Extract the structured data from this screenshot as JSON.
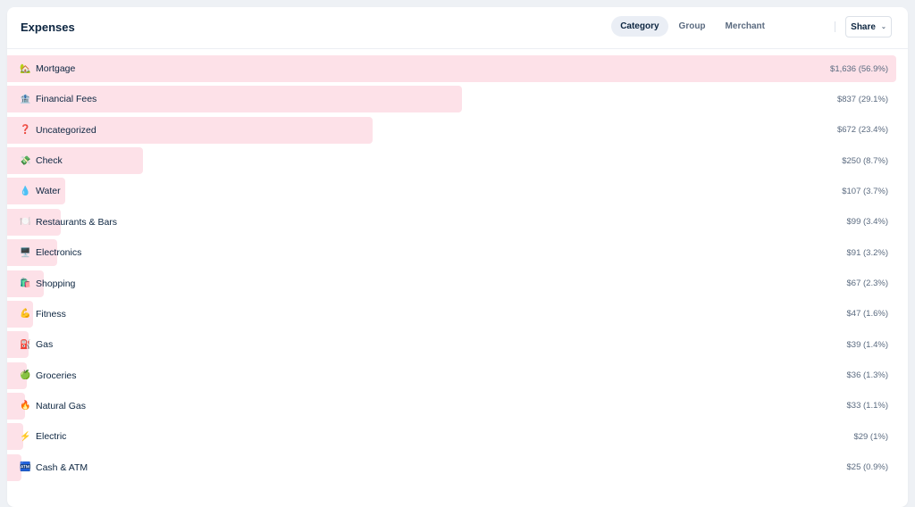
{
  "header": {
    "title": "Expenses",
    "tabs": [
      {
        "label": "Category",
        "active": true
      },
      {
        "label": "Group",
        "active": false
      },
      {
        "label": "Merchant",
        "active": false
      }
    ],
    "share_label": "Share",
    "share_icon": "chevron-down-icon"
  },
  "colors": {
    "bar": "#fde1e8",
    "text": "#0c2540",
    "muted": "#5b6b80"
  },
  "categories": [
    {
      "emoji": "🏡",
      "name": "Mortgage",
      "amount": "$1,636 (56.9%)",
      "share": 1.0
    },
    {
      "emoji": "🏦",
      "name": "Financial Fees",
      "amount": "$837 (29.1%)",
      "share": 0.512
    },
    {
      "emoji": "❓",
      "name": "Uncategorized",
      "amount": "$672 (23.4%)",
      "share": 0.411
    },
    {
      "emoji": "💸",
      "name": "Check",
      "amount": "$250 (8.7%)",
      "share": 0.153
    },
    {
      "emoji": "💧",
      "name": "Water",
      "amount": "$107 (3.7%)",
      "share": 0.065
    },
    {
      "emoji": "🍽️",
      "name": "Restaurants & Bars",
      "amount": "$99 (3.4%)",
      "share": 0.06
    },
    {
      "emoji": "🖥️",
      "name": "Electronics",
      "amount": "$91 (3.2%)",
      "share": 0.056
    },
    {
      "emoji": "🛍️",
      "name": "Shopping",
      "amount": "$67 (2.3%)",
      "share": 0.041
    },
    {
      "emoji": "💪",
      "name": "Fitness",
      "amount": "$47 (1.6%)",
      "share": 0.029
    },
    {
      "emoji": "⛽",
      "name": "Gas",
      "amount": "$39 (1.4%)",
      "share": 0.024
    },
    {
      "emoji": "🍏",
      "name": "Groceries",
      "amount": "$36 (1.3%)",
      "share": 0.022
    },
    {
      "emoji": "🔥",
      "name": "Natural Gas",
      "amount": "$33 (1.1%)",
      "share": 0.02
    },
    {
      "emoji": "⚡",
      "name": "Electric",
      "amount": "$29 (1%)",
      "share": 0.018
    },
    {
      "emoji": "🏧",
      "name": "Cash & ATM",
      "amount": "$25 (0.9%)",
      "share": 0.015
    }
  ]
}
